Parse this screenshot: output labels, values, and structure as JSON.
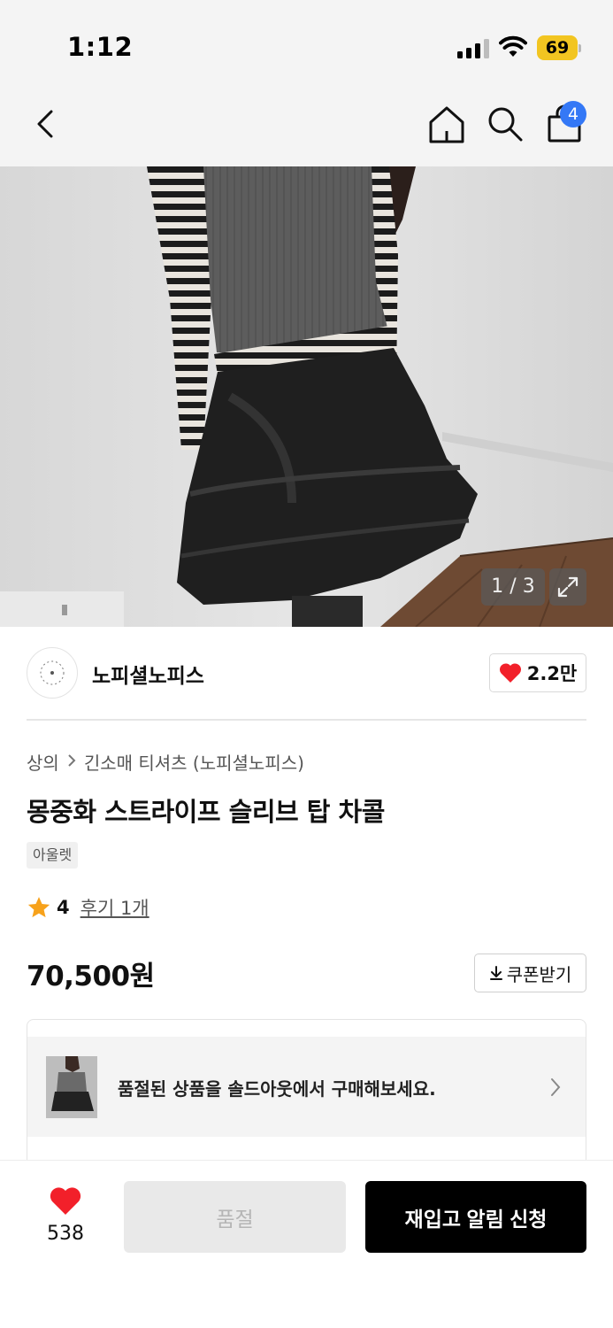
{
  "status_bar": {
    "time": "1:12",
    "battery": "69",
    "icons": [
      "signal-icon",
      "wifi-icon",
      "battery-icon"
    ]
  },
  "nav": {
    "icons": [
      "back-chevron-icon",
      "home-icon",
      "search-icon",
      "shopping-bag-icon"
    ],
    "cart_count": "4"
  },
  "gallery": {
    "indicator": "1 / 3",
    "expand_icon": "expand-icon"
  },
  "brand": {
    "name": "노피셜노피스",
    "likes": "2.2만"
  },
  "product": {
    "breadcrumb": [
      "상의",
      "긴소매 티셔츠 (노피셜노피스)"
    ],
    "title": "몽중화 스트라이프 슬리브 탑 차콜",
    "tag": "아울렛",
    "rating": "4",
    "reviews": "후기 1개",
    "price": "70,500원",
    "coupon_label": "쿠폰받기"
  },
  "soldout_banner": {
    "text": "품절된 상품을 솔드아웃에서 구매해보세요."
  },
  "bottom": {
    "wish_count": "538",
    "soldout_label": "품절",
    "restock_label": "재입고 알림 신청"
  },
  "colors": {
    "accent_blue": "#3478f6",
    "heart_red": "#f2202a",
    "star_orange": "#f7a21b",
    "battery_yellow": "#f2c521"
  }
}
